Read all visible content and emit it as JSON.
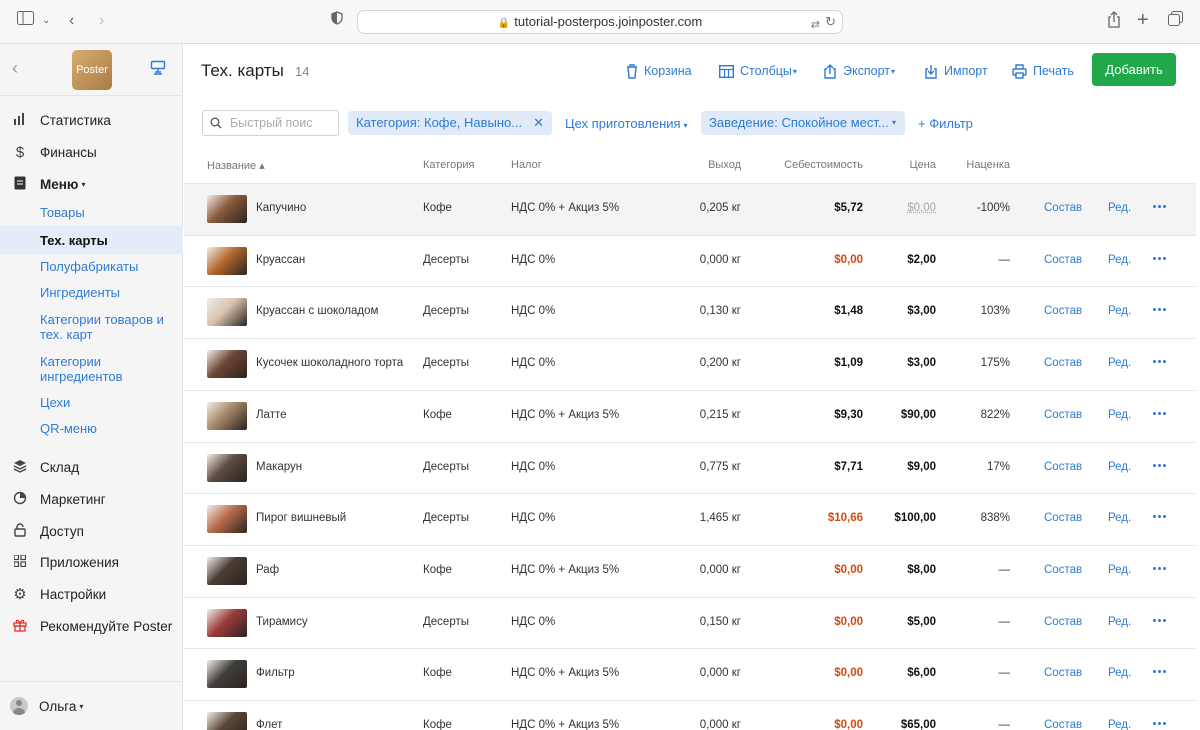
{
  "browser": {
    "url": "tutorial-posterpos.joinposter.com"
  },
  "sidebar": {
    "logo": "Poster",
    "items": [
      {
        "label": "Статистика",
        "icon": "bar-chart-icon"
      },
      {
        "label": "Финансы",
        "icon": "dollar-icon"
      },
      {
        "label": "Меню",
        "icon": "document-icon",
        "caret": "▾"
      },
      {
        "label": "Склад",
        "icon": "layers-icon"
      },
      {
        "label": "Маркетинг",
        "icon": "pie-chart-icon"
      },
      {
        "label": "Доступ",
        "icon": "lock-icon"
      },
      {
        "label": "Приложения",
        "icon": "grid-icon"
      },
      {
        "label": "Настройки",
        "icon": "gear-icon"
      },
      {
        "label": "Рекомендуйте Poster",
        "icon": "gift-icon"
      }
    ],
    "menu_sub": [
      "Товары",
      "Тех. карты",
      "Полуфабрикаты",
      "Ингредиенты",
      "Категории товаров и тех. карт",
      "Категории ингредиентов",
      "Цехи",
      "QR-меню"
    ],
    "user": "Ольга"
  },
  "header": {
    "title": "Тех. карты",
    "count": "14",
    "toolbar": {
      "trash": "Корзина",
      "columns": "Столбцы",
      "export": "Экспорт",
      "import": "Импорт",
      "print": "Печать",
      "add": "Добавить"
    }
  },
  "filters": {
    "search_placeholder": "Быстрый поис",
    "category_chip": "Категория: Кофе, Навыно...",
    "workshop": "Цех приготовления",
    "venue_chip": "Заведение: Спокойное мест...",
    "add_filter": "+ Фильтр"
  },
  "table": {
    "columns": {
      "name": "Название ▴",
      "category": "Категория",
      "tax": "Налог",
      "yield": "Выход",
      "cost": "Себестоимость",
      "price": "Цена",
      "markup": "Наценка"
    },
    "action_compose": "Состав",
    "action_edit": "Ред.",
    "rows": [
      {
        "name": "Капучино",
        "category": "Кофе",
        "tax": "НДС 0% + Акциз 5%",
        "yield": "0,205 кг",
        "cost": "$5,72",
        "price": "$0,00",
        "markup": "-100%",
        "thumb": "#8b5a3c"
      },
      {
        "name": "Круассан",
        "category": "Десерты",
        "tax": "НДС 0%",
        "yield": "0,000 кг",
        "cost": "$0,00",
        "price": "$2,00",
        "markup": "—",
        "thumb": "#b3692b"
      },
      {
        "name": "Круассан с шоколадом",
        "category": "Десерты",
        "tax": "НДС 0%",
        "yield": "0,130 кг",
        "cost": "$1,48",
        "price": "$3,00",
        "markup": "103%",
        "thumb": "#d7c3ad"
      },
      {
        "name": "Кусочек шоколадного торта",
        "category": "Десерты",
        "tax": "НДС 0%",
        "yield": "0,200 кг",
        "cost": "$1,09",
        "price": "$3,00",
        "markup": "175%",
        "thumb": "#6b4533"
      },
      {
        "name": "Латте",
        "category": "Кофе",
        "tax": "НДС 0% + Акциз 5%",
        "yield": "0,215 кг",
        "cost": "$9,30",
        "price": "$90,00",
        "markup": "822%",
        "thumb": "#a58567"
      },
      {
        "name": "Макарун",
        "category": "Десерты",
        "tax": "НДС 0%",
        "yield": "0,775 кг",
        "cost": "$7,71",
        "price": "$9,00",
        "markup": "17%",
        "thumb": "#5b4a3f"
      },
      {
        "name": "Пирог вишневый",
        "category": "Десерты",
        "tax": "НДС 0%",
        "yield": "1,465 кг",
        "cost": "$10,66",
        "price": "$100,00",
        "markup": "838%",
        "thumb": "#b86a4a"
      },
      {
        "name": "Раф",
        "category": "Кофе",
        "tax": "НДС 0% + Акциз 5%",
        "yield": "0,000 кг",
        "cost": "$0,00",
        "price": "$8,00",
        "markup": "—",
        "thumb": "#4a3a33"
      },
      {
        "name": "Тирамису",
        "category": "Десерты",
        "tax": "НДС 0%",
        "yield": "0,150 кг",
        "cost": "$0,00",
        "price": "$5,00",
        "markup": "—",
        "thumb": "#9c3b3b"
      },
      {
        "name": "Фильтр",
        "category": "Кофе",
        "tax": "НДС 0% + Акциз 5%",
        "yield": "0,000 кг",
        "cost": "$0,00",
        "price": "$6,00",
        "markup": "—",
        "thumb": "#3f3d3b"
      },
      {
        "name": "Флет",
        "category": "Кофе",
        "tax": "НДС 0% + Акциз 5%",
        "yield": "0,000 кг",
        "cost": "$0,00",
        "price": "$65,00",
        "markup": "—",
        "thumb": "#5a4637"
      }
    ]
  }
}
